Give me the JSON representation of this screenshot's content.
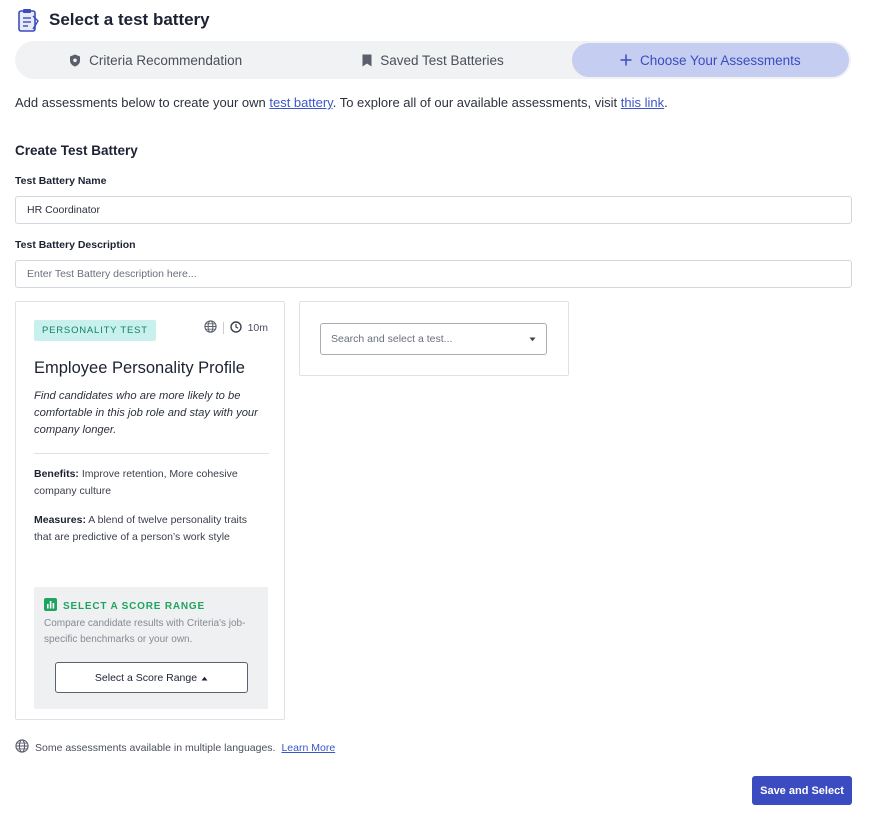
{
  "header": {
    "title": "Select a test battery",
    "icon": "clipboard-icon"
  },
  "tabs": [
    {
      "label": "Criteria Recommendation",
      "icon": "shield-icon",
      "active": false
    },
    {
      "label": "Saved Test Batteries",
      "icon": "bookmark-icon",
      "active": false
    },
    {
      "label": "Choose Your Assessments",
      "icon": "plus-icon",
      "active": true
    }
  ],
  "intro": {
    "text_before": "Add assessments below to create your own ",
    "link1": "test battery",
    "text_middle": ". To explore all of our available assessments, visit ",
    "link2": "this link",
    "text_after": "."
  },
  "form": {
    "section_title": "Create Test Battery",
    "name_label": "Test Battery Name",
    "name_value": "HR Coordinator",
    "description_label": "Test Battery Description",
    "description_placeholder": "Enter Test Battery description here..."
  },
  "assessment_card": {
    "badge": "PERSONALITY TEST",
    "duration": "10m",
    "title": "Employee Personality Profile",
    "description": "Find candidates who are more likely to be comfortable in this job role and stay with your company longer.",
    "benefits_label": "Benefits:",
    "benefits_text": " Improve retention, More cohesive company culture",
    "measures_label": "Measures:",
    "measures_text": " A blend of twelve personality traits that are predictive of a person’s work style",
    "score_range": {
      "heading": "SELECT A SCORE RANGE",
      "description": "Compare candidate results with Criteria's job-specific benchmarks or your own.",
      "button_label": "Select a Score Range"
    }
  },
  "test_select": {
    "placeholder": "Search and select a test..."
  },
  "footnote": {
    "text": "Some assessments available in multiple languages.",
    "link": "Learn More"
  },
  "actions": {
    "save_label": "Save and Select"
  },
  "colors": {
    "accent": "#3b4cc0",
    "active_tab": "#c5cdf0",
    "badge_bg": "#c8f0ed",
    "score_green": "#1fa460"
  }
}
